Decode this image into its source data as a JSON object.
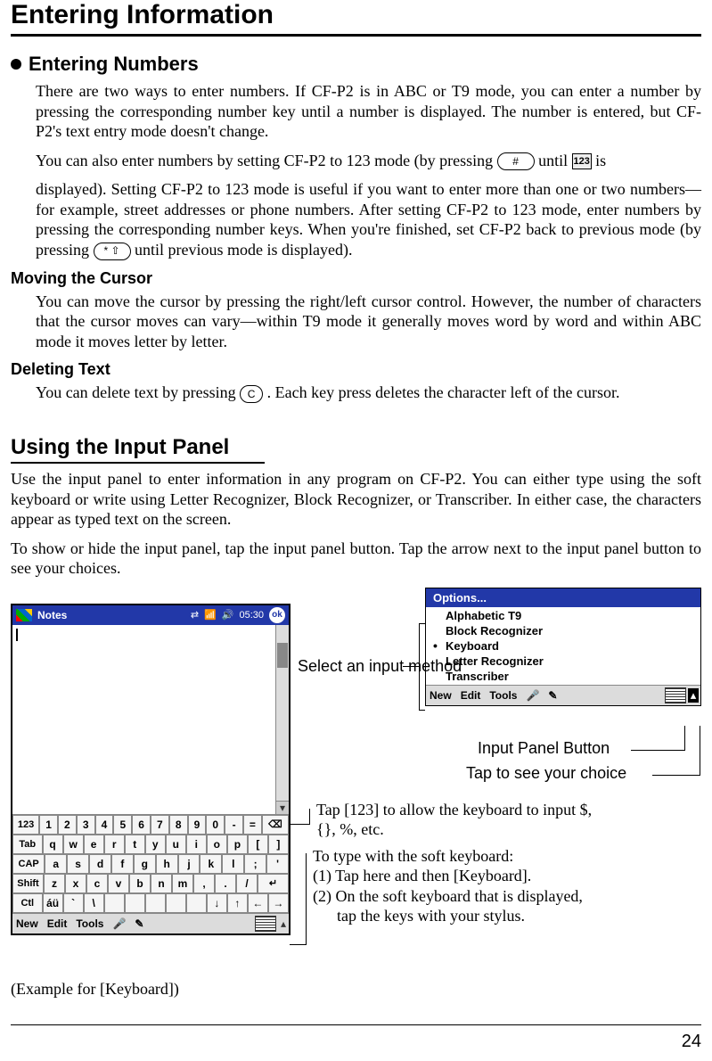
{
  "page_number": "24",
  "h1": "Entering Information",
  "sec1": {
    "title": "Entering Numbers",
    "p1": "There are two ways to enter numbers. If CF-P2 is in ABC or T9 mode, you can enter a number by pressing the corresponding number key until a number is displayed. The number is entered, but CF-P2's text entry mode doesn't change.",
    "p2a": "You can also enter numbers by setting CF-P2 to 123 mode (by pressing ",
    "p2_key1": "#",
    "p2b": " until ",
    "p2_ind": "123",
    "p2c": " is",
    "p3": "displayed). Setting CF-P2 to 123 mode is useful if you want to enter more than one or two numbers—for example, street addresses or phone numbers. After setting CF-P2 to 123 mode, enter numbers by pressing the corresponding number keys. When you're finished, set CF-P2 back to previous mode (by pressing ",
    "p3_key": "* ⇧",
    "p3b": " until previous mode is displayed)."
  },
  "sec2": {
    "title": "Moving the Cursor",
    "p1": "You can move the cursor by pressing the right/left cursor control. However, the number of characters that the cursor moves can vary—within T9 mode it generally moves word by word and within ABC mode it moves letter by letter."
  },
  "sec3": {
    "title": "Deleting Text",
    "p1a": "You can delete text by pressing ",
    "key": "C",
    "p1b": ". Each key press deletes the character left of the cursor."
  },
  "sec4": {
    "title": "Using the Input Panel",
    "p1": "Use the input panel to enter information in any program on CF-P2. You can either type using the soft keyboard or write using Letter Recognizer, Block Recognizer, or Transcriber. In either case, the characters appear as typed text on the screen.",
    "p2": "To show or hide the input panel, tap the input panel button. Tap the arrow next to the input panel button to see your choices."
  },
  "pda": {
    "app": "Notes",
    "time": "05:30",
    "ok": "ok",
    "bottom": {
      "new": "New",
      "edit": "Edit",
      "tools": "Tools"
    },
    "kbd": {
      "row1": [
        "123",
        "1",
        "2",
        "3",
        "4",
        "5",
        "6",
        "7",
        "8",
        "9",
        "0",
        "-",
        "=",
        "⌫"
      ],
      "row2": [
        "Tab",
        "q",
        "w",
        "e",
        "r",
        "t",
        "y",
        "u",
        "i",
        "o",
        "p",
        "[",
        "]"
      ],
      "row3": [
        "CAP",
        "a",
        "s",
        "d",
        "f",
        "g",
        "h",
        "j",
        "k",
        "l",
        ";",
        "'"
      ],
      "row4": [
        "Shift",
        "z",
        "x",
        "c",
        "v",
        "b",
        "n",
        "m",
        ",",
        ".",
        "/",
        "↵"
      ],
      "row5": [
        "Ctl",
        "áü",
        "`",
        "\\",
        "",
        "",
        "",
        "",
        "",
        "↓",
        "↑",
        "←",
        "→"
      ]
    }
  },
  "options_popup": {
    "title": "Options...",
    "items": [
      "Alphabetic T9",
      "Block Recognizer",
      "Keyboard",
      "Letter Recognizer",
      "Transcriber"
    ],
    "selected_index": 2,
    "bottom": {
      "new": "New",
      "edit": "Edit",
      "tools": "Tools"
    }
  },
  "callouts": {
    "select_input": "Select an input method",
    "input_panel_btn": "Input Panel Button",
    "tap_choice": "Tap to see your choice",
    "tap_123_a": "Tap [123] to allow the keyboard to input $,",
    "tap_123_b": "{}, %, etc.",
    "type_soft_hdr": "To type with the soft keyboard:",
    "type_soft_1": "(1) Tap here and then [Keyboard].",
    "type_soft_2": "(2) On the soft keyboard that is displayed,",
    "type_soft_2b": "      tap the keys with your stylus."
  },
  "example_caption": "(Example for [Keyboard])"
}
